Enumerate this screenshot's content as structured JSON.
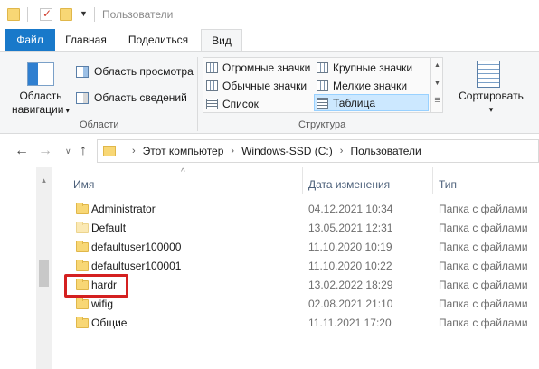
{
  "window": {
    "title": "Пользователи"
  },
  "ribbon_tabs": [
    {
      "label": "Файл"
    },
    {
      "label": "Главная"
    },
    {
      "label": "Поделиться"
    },
    {
      "label": "Вид"
    }
  ],
  "ribbon": {
    "areas": {
      "nav_pane_label_1": "Область",
      "nav_pane_label_2": "навигации",
      "nav_pane_arrow": "▾",
      "preview_pane": "Область просмотра",
      "details_pane": "Область сведений",
      "group_label": "Области"
    },
    "structure": {
      "items": [
        {
          "label": "Огромные значки"
        },
        {
          "label": "Крупные значки"
        },
        {
          "label": "Обычные значки"
        },
        {
          "label": "Мелкие значки"
        },
        {
          "label": "Список"
        },
        {
          "label": "Таблица"
        }
      ],
      "selected": "Таблица",
      "group_label": "Структура"
    },
    "sort": {
      "label": "Сортировать",
      "arrow": "▾"
    }
  },
  "address_bar": {
    "crumbs": [
      "Этот компьютер",
      "Windows-SSD (C:)",
      "Пользователи"
    ],
    "separator": "›"
  },
  "columns": {
    "name": "Имя",
    "date": "Дата изменения",
    "type": "Тип"
  },
  "files": [
    {
      "name": "Administrator",
      "date": "04.12.2021 10:34",
      "type": "Папка с файлами"
    },
    {
      "name": "Default",
      "date": "13.05.2021 12:31",
      "type": "Папка с файлами"
    },
    {
      "name": "defaultuser100000",
      "date": "11.10.2020 10:19",
      "type": "Папка с файлами"
    },
    {
      "name": "defaultuser100001",
      "date": "11.10.2020 10:22",
      "type": "Папка с файлами"
    },
    {
      "name": "hardr",
      "date": "13.02.2022 18:29",
      "type": "Папка с файлами"
    },
    {
      "name": "wifig",
      "date": "02.08.2021 21:10",
      "type": "Папка с файлами"
    },
    {
      "name": "Общие",
      "date": "11.11.2021 17:20",
      "type": "Папка с файлами"
    }
  ],
  "colors": {
    "file_tab": "#1979ca",
    "selected_layout": "#cce8ff",
    "highlight": "#d42020",
    "folder": "#f8d775"
  },
  "icons": {
    "back": "←",
    "forward": "→",
    "recent": "∨",
    "up": "↑",
    "sort_caret": "^"
  }
}
